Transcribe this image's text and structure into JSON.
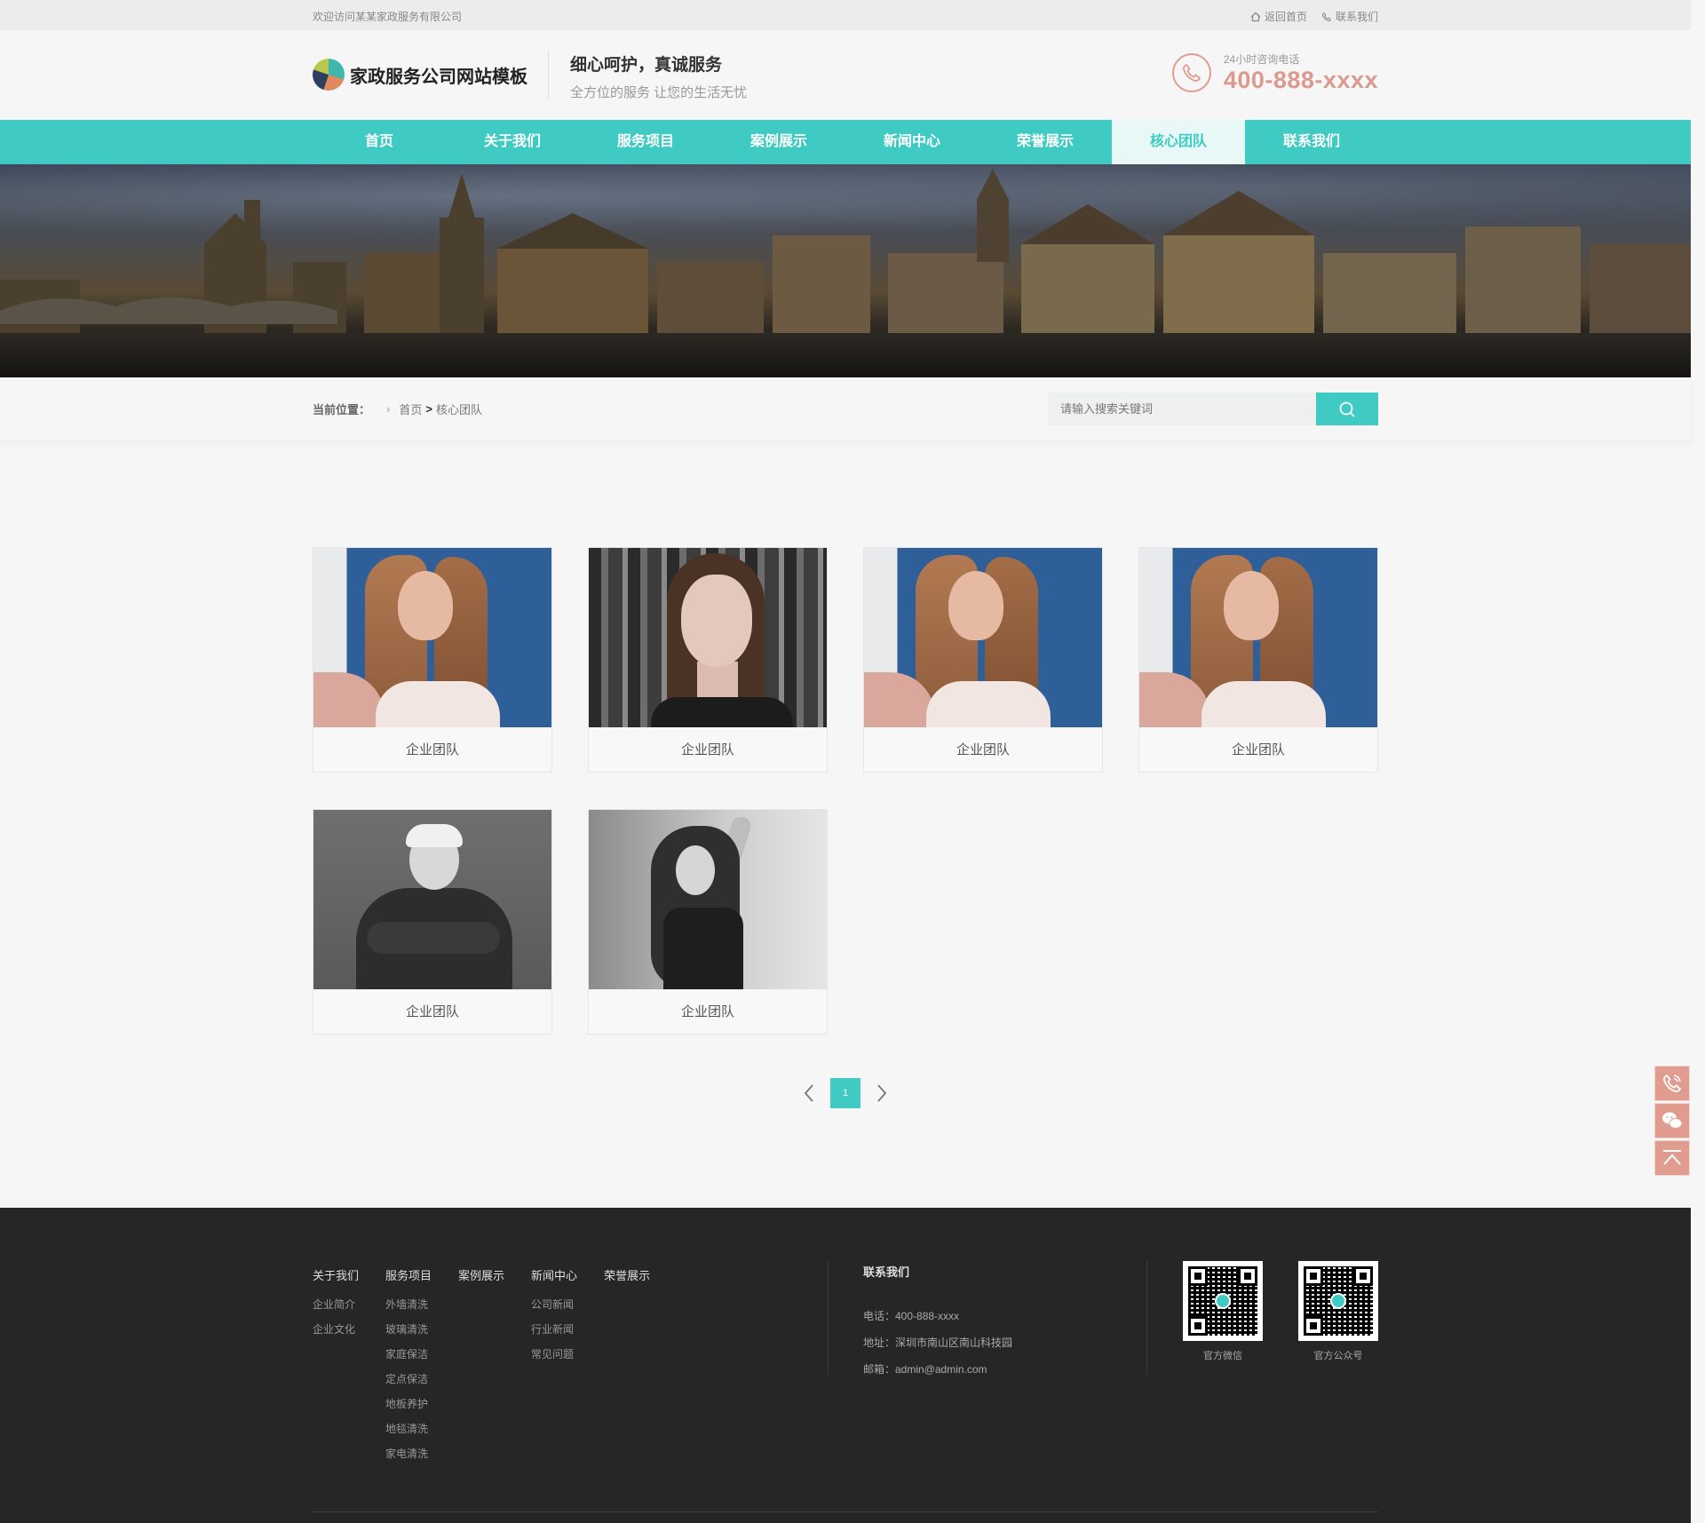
{
  "topbar": {
    "welcome": "欢迎访问某某家政服务有限公司",
    "home_link": "返回首页",
    "contact_link": "联系我们"
  },
  "header": {
    "logo_text": "家政服务公司网站模板",
    "slogan_main": "细心呵护，真诚服务",
    "slogan_sub": "全方位的服务 让您的生活无忧",
    "hotline_label": "24小时咨询电话",
    "hotline_number": "400-888-xxxx"
  },
  "nav": {
    "items": [
      "首页",
      "关于我们",
      "服务项目",
      "案例展示",
      "新闻中心",
      "荣誉展示",
      "核心团队",
      "联系我们"
    ],
    "active": "核心团队"
  },
  "breadcrumb": {
    "label": "当前位置：",
    "home": "首页",
    "separator": ">",
    "current": "核心团队"
  },
  "search": {
    "placeholder": "请输入搜索关键词"
  },
  "team": {
    "cards": [
      {
        "caption": "企业团队",
        "photo": "woman-curly-hair-blue-backdrop"
      },
      {
        "caption": "企业团队",
        "photo": "woman-bookshelf-portrait"
      },
      {
        "caption": "企业团队",
        "photo": "woman-curly-hair-blue-backdrop"
      },
      {
        "caption": "企业团队",
        "photo": "woman-curly-hair-blue-backdrop"
      },
      {
        "caption": "企业团队",
        "photo": "older-man-crossed-arms-bw"
      },
      {
        "caption": "企业团队",
        "photo": "woman-long-hair-bw"
      }
    ]
  },
  "pagination": {
    "current_page": "1"
  },
  "footer": {
    "columns": [
      {
        "title": "关于我们",
        "items": [
          "企业简介",
          "企业文化"
        ]
      },
      {
        "title": "服务项目",
        "items": [
          "外墙清洗",
          "玻璃清洗",
          "家庭保洁",
          "定点保洁",
          "地板养护",
          "地毯清洗",
          "家电清洗"
        ]
      },
      {
        "title": "案例展示",
        "items": []
      },
      {
        "title": "新闻中心",
        "items": [
          "公司新闻",
          "行业新闻",
          "常见问题"
        ]
      },
      {
        "title": "荣誉展示",
        "items": []
      }
    ],
    "contact": {
      "title": "联系我们",
      "phone": "电话：400-888-xxxx",
      "address": "地址：深圳市南山区南山科技园",
      "email": "邮箱：admin@admin.com"
    },
    "qrcodes": [
      {
        "label": "官方微信"
      },
      {
        "label": "官方公众号"
      }
    ]
  },
  "colors": {
    "accent": "#3fcbc4",
    "hotline": "#dc9a8e",
    "footer_bg": "#262626"
  }
}
